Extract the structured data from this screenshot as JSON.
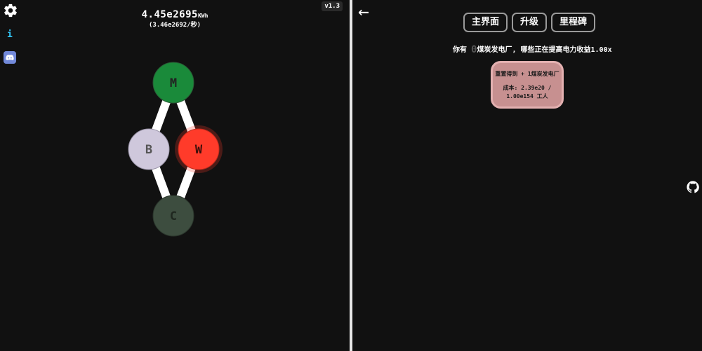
{
  "left_pane": {
    "energy_value": "4.45e2695",
    "energy_unit": "KWh",
    "rate": "(3.46e2692/秒)",
    "version": "v1.3",
    "sidebar": {
      "settings_icon": "gear-icon",
      "info_label": "i",
      "discord_icon": "discord-icon"
    },
    "tree": {
      "nodes": [
        {
          "id": "M",
          "label": "M",
          "color": "#1a8a3a"
        },
        {
          "id": "B",
          "label": "B",
          "color": "#cfc8dc"
        },
        {
          "id": "W",
          "label": "W",
          "color": "#ff3b2a"
        },
        {
          "id": "C",
          "label": "C",
          "color": "#3d4d3f"
        }
      ]
    }
  },
  "right_pane": {
    "back_icon": "arrow-left-icon",
    "tabs": [
      "主界面",
      "升级",
      "里程碑"
    ],
    "message": {
      "prefix": "你有 ",
      "count": "0",
      "suffix": "煤炭发电厂, 哪些正在提高电力收益1.00x"
    },
    "reset_button": {
      "line1": "重置得到 + 1煤炭发电厂",
      "line2": "成本: 2.39e20 /",
      "line3": "1.00e154 工人"
    },
    "github_icon": "github-icon"
  }
}
